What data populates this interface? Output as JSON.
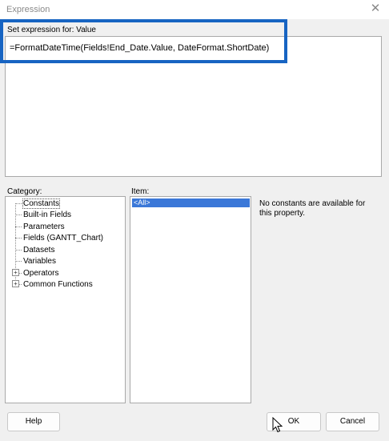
{
  "window": {
    "title": "Expression"
  },
  "expression": {
    "label": "Set expression for: Value",
    "value": "=FormatDateTime(Fields!End_Date.Value, DateFormat.ShortDate)"
  },
  "category": {
    "label": "Category:",
    "items": [
      {
        "label": "Constants",
        "selected": true
      },
      {
        "label": "Built-in Fields"
      },
      {
        "label": "Parameters"
      },
      {
        "label": "Fields (GANTT_Chart)"
      },
      {
        "label": "Datasets"
      },
      {
        "label": "Variables"
      },
      {
        "label": "Operators",
        "expandable": true
      },
      {
        "label": "Common Functions",
        "expandable": true
      }
    ]
  },
  "item": {
    "label": "Item:",
    "items": [
      {
        "label": "<All>",
        "selected": true
      }
    ]
  },
  "description": {
    "text": "No constants are available for this property."
  },
  "buttons": {
    "help": "Help",
    "ok": "OK",
    "cancel": "Cancel"
  },
  "colors": {
    "highlight_border": "#1764c2",
    "selection": "#3b78d8"
  },
  "icons": {
    "close": "close-icon",
    "expand": "expand-plus-icon",
    "cursor": "mouse-pointer-icon"
  }
}
